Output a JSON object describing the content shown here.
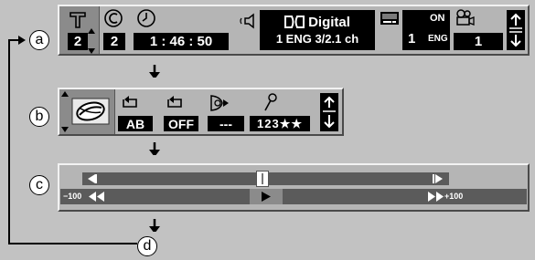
{
  "labels": {
    "a": "a",
    "b": "b",
    "c": "c",
    "d": "d"
  },
  "panel_a": {
    "title_value": "2",
    "chapter_value": "2",
    "time_value": "1 : 46 : 50",
    "audio_format": "Digital",
    "audio_detail": "1 ENG  3/2.1 ch",
    "subtitle_state": "ON",
    "subtitle_number": "1",
    "subtitle_lang": "ENG",
    "angle_value": "1"
  },
  "panel_b": {
    "repeat_ab": "AB",
    "repeat_off": "OFF",
    "disc_value": "---",
    "marker_value": "123★★"
  },
  "panel_c": {
    "speed_min": "−100",
    "speed_max": "+100"
  },
  "colors": {
    "background": "#c2c2c2",
    "bar": "#b5b5b5",
    "selected": "#8b8b8b",
    "value_box": "#000000",
    "track": "#5b5b5b"
  }
}
